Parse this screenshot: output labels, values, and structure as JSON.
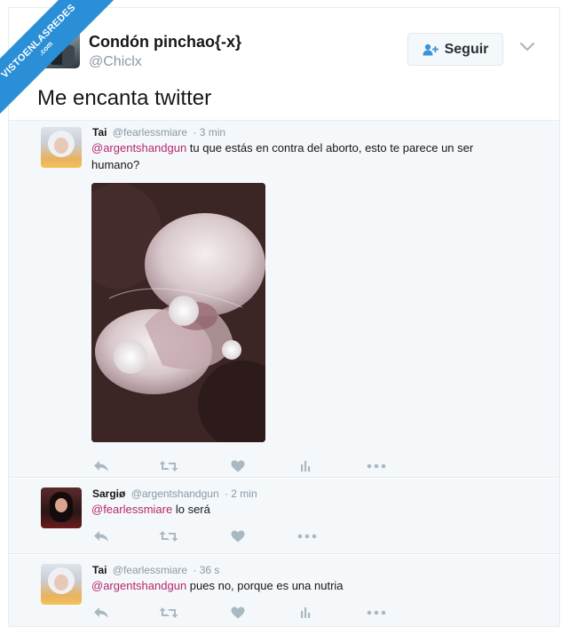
{
  "watermark": {
    "main": "VISTOENLASREDES",
    "sub": ".com"
  },
  "header": {
    "name": "Condón pinchao{-x}",
    "handle": "@Chiclx",
    "follow_label": "Seguir"
  },
  "tweet": {
    "text": "Me encanta twitter"
  },
  "replies": [
    {
      "name": "Tai",
      "handle": "@fearlessmiare",
      "time": "· 3 min",
      "mention": "@argentshandgun",
      "text": " tu que estás en contra del aborto, esto te parece un ser humano?"
    },
    {
      "name": "Sargiø",
      "handle": "@argentshandgun",
      "time": "· 2 min",
      "mention": "@fearlessmiare",
      "text": " lo será"
    },
    {
      "name": "Tai",
      "handle": "@fearlessmiare",
      "time": "· 36 s",
      "mention": "@argentshandgun",
      "text": " pues no, porque es una nutria"
    }
  ],
  "colors": {
    "mention": "#b4276d",
    "muted": "#8899a6",
    "reply_bg": "#f5f8fa"
  }
}
